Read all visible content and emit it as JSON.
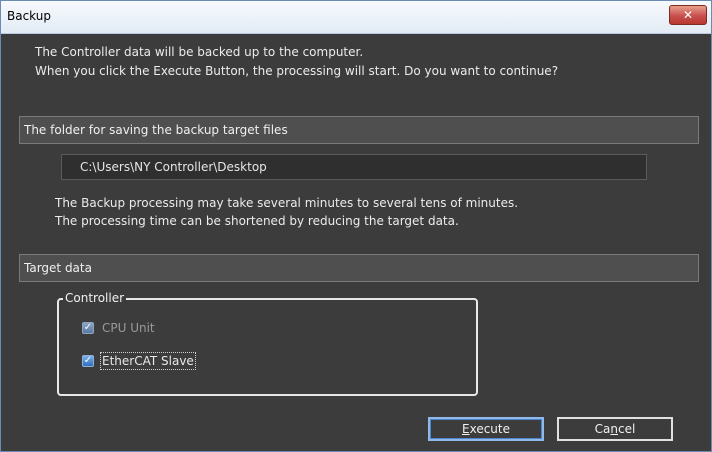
{
  "window": {
    "title": "Backup"
  },
  "intro": {
    "line1": "The Controller data will be backed up to the computer.",
    "line2": "When you click the Execute Button, the processing will start. Do you want to continue?"
  },
  "folder_section": {
    "header": "The folder for saving the backup target files",
    "path_value": "C:\\Users\\NY Controller\\Desktop"
  },
  "notice": {
    "line1": "The Backup processing may take several minutes to several tens of minutes.",
    "line2": "The processing time can be shortened by reducing the target data."
  },
  "target_section": {
    "header": "Target data",
    "group_label": "Controller",
    "items": [
      {
        "label": "CPU Unit",
        "checked": true,
        "enabled": false
      },
      {
        "label": "EtherCAT Slave",
        "checked": true,
        "enabled": true
      }
    ]
  },
  "buttons": {
    "execute": {
      "prefix": "",
      "mnemonic": "E",
      "suffix": "xecute"
    },
    "cancel": {
      "prefix": "Ca",
      "mnemonic": "n",
      "suffix": "cel"
    }
  },
  "colors": {
    "background": "#3c3c3c",
    "close_button": "#c75050",
    "checkbox": "#2d6fc0"
  },
  "icons": {
    "close": "close-icon",
    "check": "checkmark-icon"
  }
}
